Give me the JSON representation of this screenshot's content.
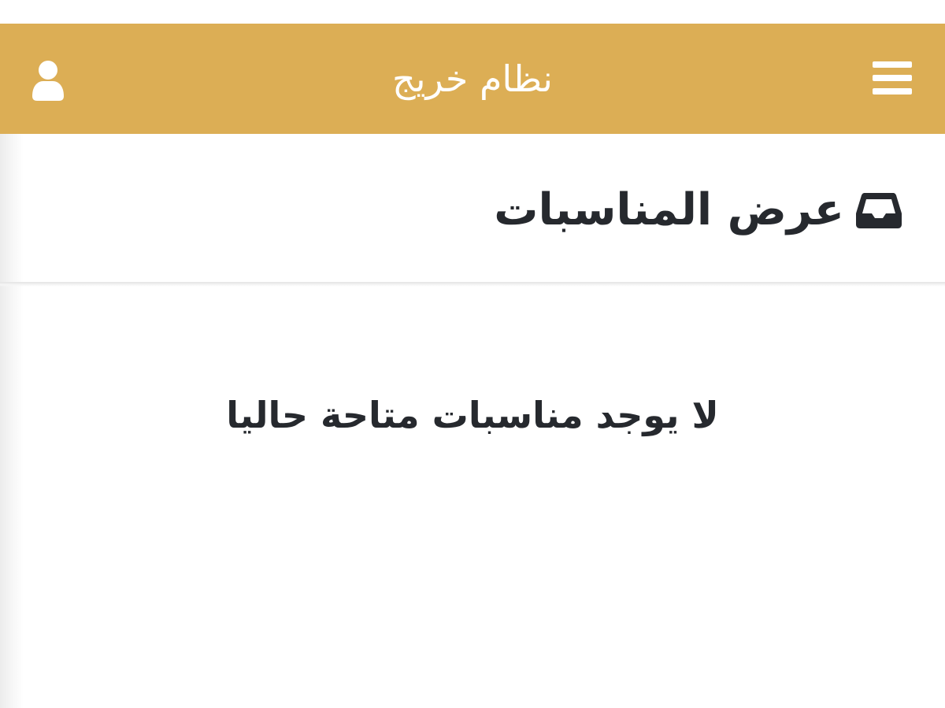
{
  "app": {
    "title": "نظام خريج"
  },
  "header": {
    "menu_icon": "hamburger-menu-icon",
    "user_icon": "user-icon",
    "background_color": "#dcae55",
    "text_color": "#ffffff"
  },
  "page": {
    "title": "عرض المناسبات",
    "title_icon": "inbox-icon",
    "empty_message": "لا يوجد مناسبات متاحة حاليا",
    "text_color": "#26292e"
  }
}
